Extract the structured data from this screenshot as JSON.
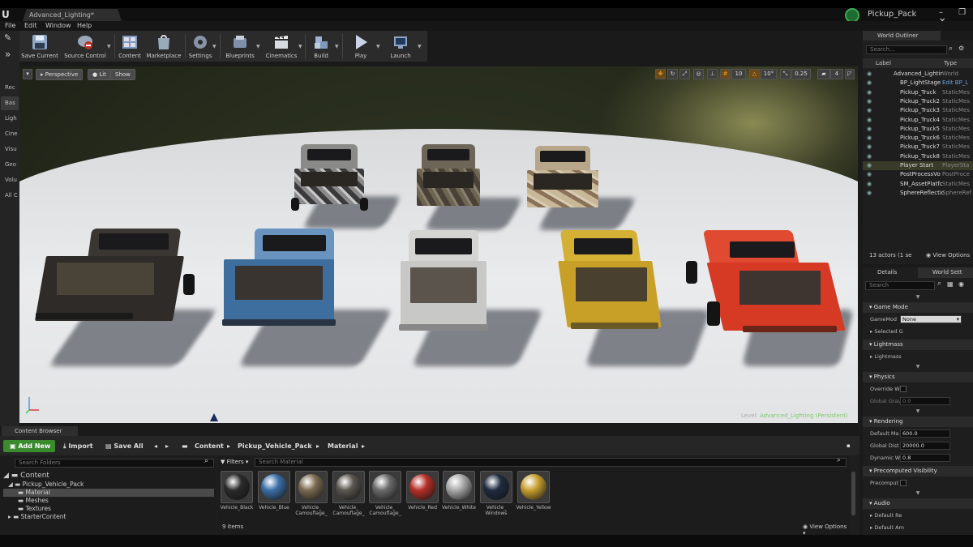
{
  "titlebar": {
    "tab": "Advanced_Lighting*",
    "project": "Pickup_Pack",
    "controls": "– ❐ ✕"
  },
  "menu": [
    "File",
    "Edit",
    "Window",
    "Help"
  ],
  "modes": [
    "Rec",
    "Bas",
    "Ligh",
    "Cine",
    "Visu",
    "Geo",
    "Volu",
    "All C"
  ],
  "toolbar": [
    {
      "label": "Save Current",
      "icon": "save-icon"
    },
    {
      "label": "Source Control",
      "icon": "source-control-icon"
    },
    {
      "label": "Content",
      "icon": "content-icon"
    },
    {
      "label": "Marketplace",
      "icon": "marketplace-icon"
    },
    {
      "label": "Settings",
      "icon": "settings-icon"
    },
    {
      "label": "Blueprints",
      "icon": "blueprints-icon"
    },
    {
      "label": "Cinematics",
      "icon": "cinematics-icon"
    },
    {
      "label": "Build",
      "icon": "build-icon"
    },
    {
      "label": "Play",
      "icon": "play-icon"
    },
    {
      "label": "Launch",
      "icon": "launch-icon"
    }
  ],
  "viewport": {
    "perspective": "Perspective",
    "lit": "Lit",
    "show": "Show",
    "grid_snap": "10",
    "rot_snap": "10°",
    "scale_snap": "0.25",
    "cam_speed": "4",
    "level_prefix": "Level: ",
    "level_name": "Advanced_Lighting (Persistent)"
  },
  "outliner": {
    "tab": "World Outliner",
    "search": "Search...",
    "col_label": "Label",
    "col_type": "Type",
    "rows": [
      {
        "label": "Advanced_Lightir",
        "type": "World"
      },
      {
        "label": "BP_LightStage",
        "type": "Edit BP_L"
      },
      {
        "label": "Pickup_Truck",
        "type": "StaticMes"
      },
      {
        "label": "Pickup_Truck2",
        "type": "StaticMes"
      },
      {
        "label": "Pickup_Truck3",
        "type": "StaticMes"
      },
      {
        "label": "Pickup_Truck4",
        "type": "StaticMes"
      },
      {
        "label": "Pickup_Truck5",
        "type": "StaticMes"
      },
      {
        "label": "Pickup_Truck6",
        "type": "StaticMes"
      },
      {
        "label": "Pickup_Truck7",
        "type": "StaticMes"
      },
      {
        "label": "Pickup_Truck8",
        "type": "StaticMes"
      },
      {
        "label": "Player Start",
        "type": "PlayerSta"
      },
      {
        "label": "PostProcessVo",
        "type": "PostProce"
      },
      {
        "label": "SM_AssetPlatfc",
        "type": "StaticMes"
      },
      {
        "label": "SphereReflectic",
        "type": "SphereRef"
      }
    ],
    "actors": "13 actors (1 se",
    "view_options": "View Options"
  },
  "details": {
    "tab1": "Details",
    "tab2": "World Sett",
    "search": "Search",
    "game_mode": "Game Mode",
    "game_mode_prop": "GameMod",
    "game_mode_val": "None",
    "selected": "Selected G",
    "lightmass": "Lightmass",
    "lightmass_prop": "Lightmass",
    "physics": "Physics",
    "override": "Override W",
    "global_grav": "Global Grav",
    "global_grav_val": "0.0",
    "rendering": "Rendering",
    "default_max": "Default Ma",
    "default_max_val": "600.0",
    "global_dist": "Global Dist",
    "global_dist_val": "20000.0",
    "dynamic": "Dynamic W",
    "dynamic_val": "0.8",
    "precomputed": "Precomputed Visibility",
    "precompute": "Precomput",
    "audio": "Audio",
    "default_re": "Default Re",
    "default_am": "Default Am"
  },
  "content_browser": {
    "tab": "Content Browser",
    "add_new": "Add New",
    "import": "Import",
    "save_all": "Save All",
    "crumbs": [
      "Content",
      "Pickup_Vehicle_Pack",
      "Material"
    ],
    "search_folders": "Search Folders",
    "filters": "Filters",
    "search_material": "Search Material",
    "tree": [
      "Content",
      "Pickup_Vehicle_Pack",
      "Material",
      "Meshes",
      "Textures",
      "StarterContent"
    ],
    "assets": [
      {
        "name": "Vehicle_Black",
        "color": "#2a2a2a"
      },
      {
        "name": "Vehicle_Blue",
        "color": "#3b6fa8"
      },
      {
        "name": "Vehicle_ Camouflage_",
        "color": "#7a6a50"
      },
      {
        "name": "Vehicle_ Camouflage_",
        "color": "#5a5650"
      },
      {
        "name": "Vehicle_ Camouflage_",
        "color": "#6a6a6a"
      },
      {
        "name": "Vehicle_Red",
        "color": "#b53028"
      },
      {
        "name": "Vehicle_White",
        "color": "#aaaaaa"
      },
      {
        "name": "Vehicle_ Windows",
        "color": "#1f2c40"
      },
      {
        "name": "Vehicle_Yellow",
        "color": "#c8a030"
      }
    ],
    "items": "9 items",
    "view_options": "View Options"
  }
}
